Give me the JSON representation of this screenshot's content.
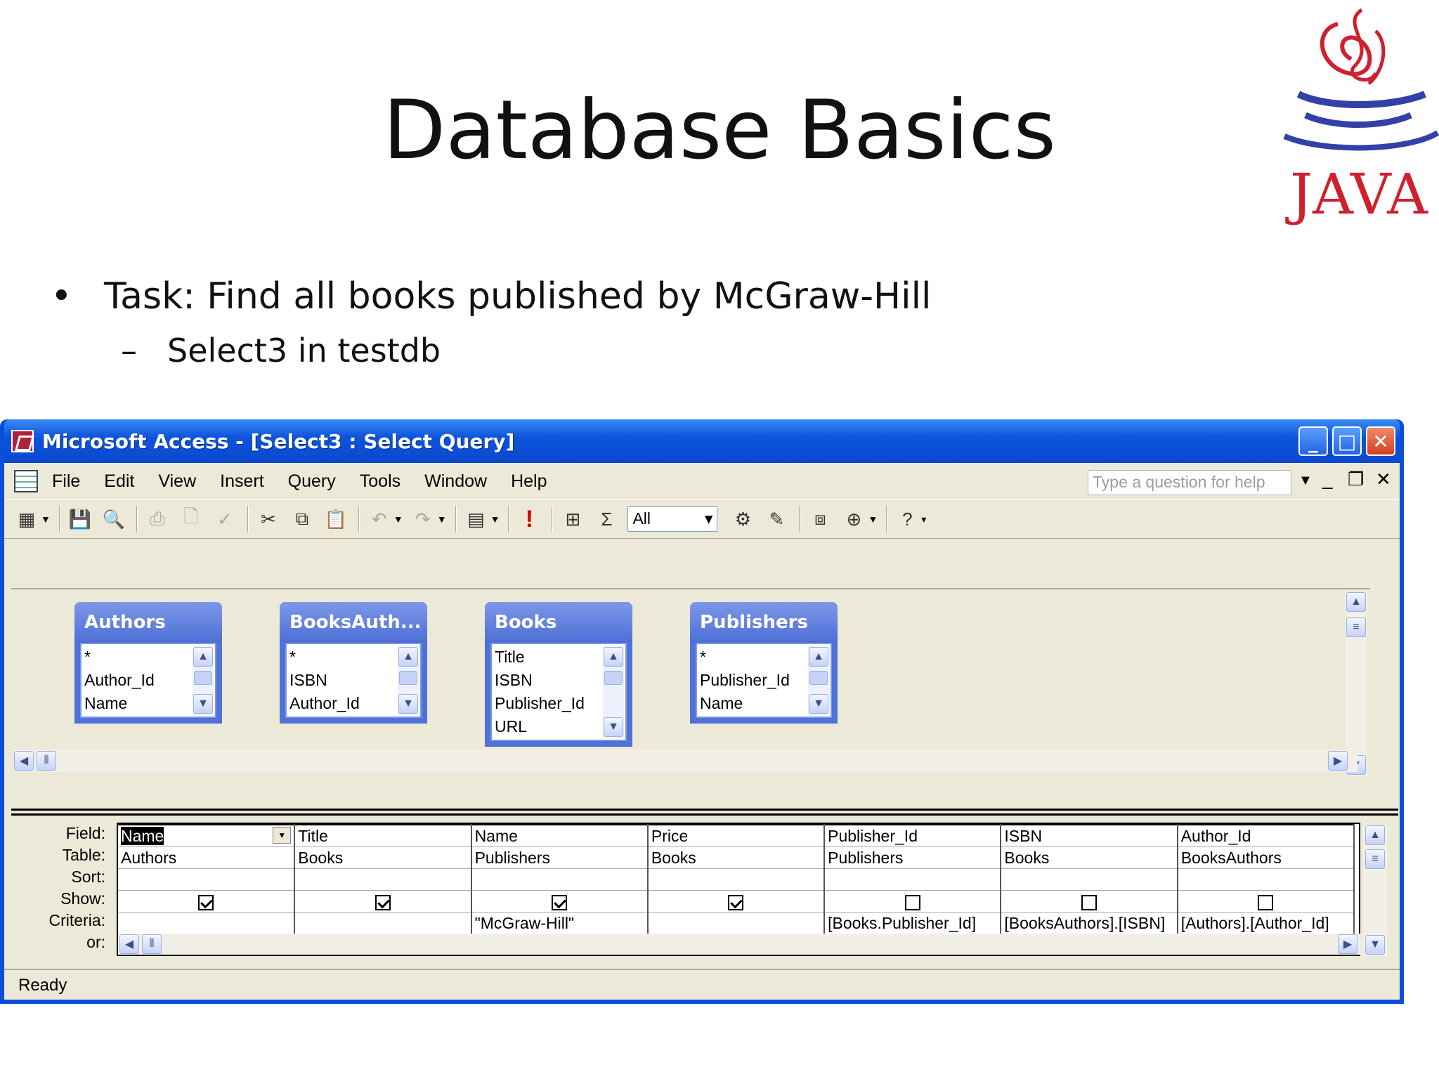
{
  "slide": {
    "title": "Database Basics",
    "bullet": "Task: Find all books published by McGraw-Hill",
    "sub_bullet": "Select3 in testdb",
    "bullet_marker": "•",
    "sub_marker": "–",
    "logo_text": "JAVA"
  },
  "window": {
    "title": "Microsoft Access - [Select3 : Select Query]",
    "menu": [
      "File",
      "Edit",
      "View",
      "Insert",
      "Query",
      "Tools",
      "Window",
      "Help"
    ],
    "help_placeholder": "Type a question for help",
    "top_values": "All",
    "status": "Ready"
  },
  "field_lists": [
    {
      "title": "Authors",
      "fields": [
        "*",
        "Author_Id",
        "Name"
      ]
    },
    {
      "title": "BooksAuth...",
      "fields": [
        "*",
        "ISBN",
        "Author_Id"
      ]
    },
    {
      "title": "Books",
      "fields": [
        "Title",
        "ISBN",
        "Publisher_Id",
        "URL"
      ]
    },
    {
      "title": "Publishers",
      "fields": [
        "*",
        "Publisher_Id",
        "Name"
      ]
    }
  ],
  "grid": {
    "row_labels": [
      "Field:",
      "Table:",
      "Sort:",
      "Show:",
      "Criteria:",
      "or:"
    ],
    "columns": [
      {
        "field": "Name",
        "table": "Authors",
        "show": true,
        "criteria": ""
      },
      {
        "field": "Title",
        "table": "Books",
        "show": true,
        "criteria": ""
      },
      {
        "field": "Name",
        "table": "Publishers",
        "show": true,
        "criteria": "\"McGraw-Hill\""
      },
      {
        "field": "Price",
        "table": "Books",
        "show": true,
        "criteria": ""
      },
      {
        "field": "Publisher_Id",
        "table": "Publishers",
        "show": false,
        "criteria": "[Books.Publisher_Id]"
      },
      {
        "field": "ISBN",
        "table": "Books",
        "show": false,
        "criteria": "[BooksAuthors].[ISBN]"
      },
      {
        "field": "Author_Id",
        "table": "BooksAuthors",
        "show": false,
        "criteria": "[Authors].[Author_Id]"
      }
    ]
  }
}
